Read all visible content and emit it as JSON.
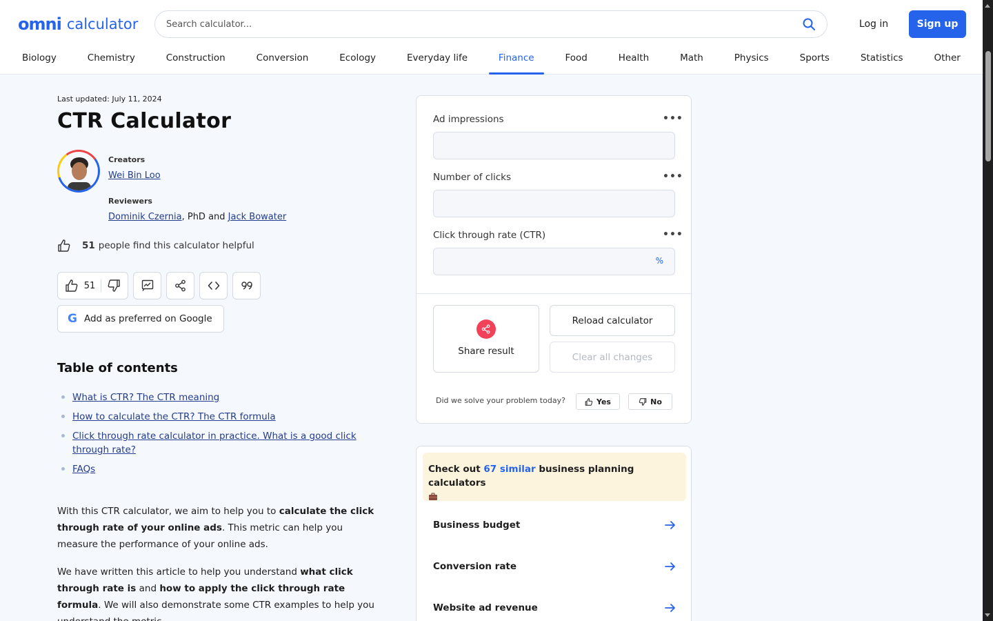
{
  "header": {
    "logo_text": "calculator",
    "logo_mark": "omni",
    "search_placeholder": "Search calculator...",
    "login_label": "Log in",
    "signup_label": "Sign up"
  },
  "nav": {
    "items": [
      "Biology",
      "Chemistry",
      "Construction",
      "Conversion",
      "Ecology",
      "Everyday life",
      "Finance",
      "Food",
      "Health",
      "Math",
      "Physics",
      "Sports",
      "Statistics",
      "Other"
    ],
    "active": "Finance"
  },
  "article": {
    "updated_prefix": "Last updated:",
    "updated_date": "July 11, 2024",
    "title": "CTR Calculator",
    "creators_label": "Creators",
    "creator_name": "Wei Bin Loo",
    "reviewers_label": "Reviewers",
    "reviewer_1": "Dominik Czernia",
    "reviewer_1_suffix": ", PhD and ",
    "reviewer_2": "Jack Bowater",
    "helpful_count": "51",
    "helpful_text": "people find this calculator helpful",
    "vote_count": "51",
    "google_btn_label": "Add as preferred on Google",
    "google_letter": "G",
    "toc_title": "Table of contents",
    "toc": [
      "What is CTR? The CTR meaning",
      "How to calculate the CTR? The CTR formula",
      "Click through rate calculator in practice. What is a good click through rate?",
      "FAQs"
    ],
    "para1": {
      "t1": "With this CTR calculator, we aim to help you to ",
      "b1": "calculate the click through rate of your online ads",
      "t2": ". This metric can help you measure the performance of your online ads."
    },
    "para2": {
      "t1": "We have written this article to help you understand ",
      "b1": "what click through rate is",
      "t2": " and ",
      "b2": "how to apply the click through rate formula",
      "t3": ". We will also demonstrate some CTR examples to help you understand the metric."
    }
  },
  "calculator": {
    "fields": [
      {
        "label": "Ad impressions",
        "value": "",
        "unit": ""
      },
      {
        "label": "Number of clicks",
        "value": "",
        "unit": ""
      },
      {
        "label": "Click through rate (CTR)",
        "value": "",
        "unit": "%"
      }
    ],
    "more_label": "•••",
    "share_label": "Share result",
    "reload_label": "Reload calculator",
    "clear_label": "Clear all changes",
    "solve_question": "Did we solve your problem today?",
    "yes_label": "Yes",
    "no_label": "No"
  },
  "similar": {
    "prefix": "Check out ",
    "count_link": "67 similar",
    "suffix": " business planning calculators",
    "items": [
      "Business budget",
      "Conversion rate",
      "Website ad revenue"
    ]
  },
  "colors": {
    "brand": "#2563eb",
    "share_red": "#f1425a",
    "similar_bg": "#fdf4de"
  }
}
